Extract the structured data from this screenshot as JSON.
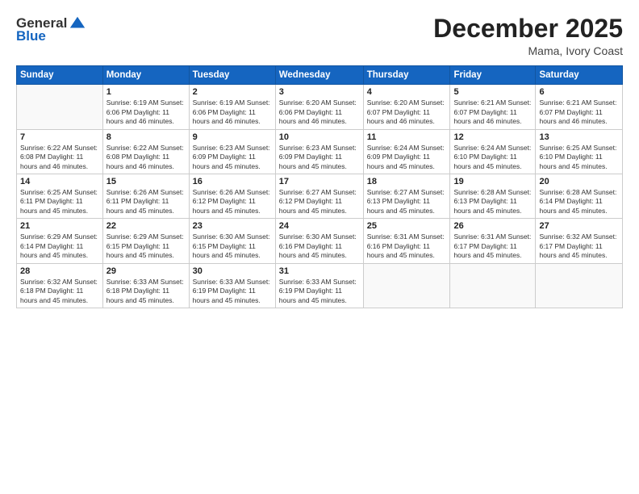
{
  "logo": {
    "general": "General",
    "blue": "Blue"
  },
  "title": "December 2025",
  "subtitle": "Mama, Ivory Coast",
  "days_of_week": [
    "Sunday",
    "Monday",
    "Tuesday",
    "Wednesday",
    "Thursday",
    "Friday",
    "Saturday"
  ],
  "weeks": [
    [
      {
        "day": "",
        "info": ""
      },
      {
        "day": "1",
        "info": "Sunrise: 6:19 AM\nSunset: 6:06 PM\nDaylight: 11 hours\nand 46 minutes."
      },
      {
        "day": "2",
        "info": "Sunrise: 6:19 AM\nSunset: 6:06 PM\nDaylight: 11 hours\nand 46 minutes."
      },
      {
        "day": "3",
        "info": "Sunrise: 6:20 AM\nSunset: 6:06 PM\nDaylight: 11 hours\nand 46 minutes."
      },
      {
        "day": "4",
        "info": "Sunrise: 6:20 AM\nSunset: 6:07 PM\nDaylight: 11 hours\nand 46 minutes."
      },
      {
        "day": "5",
        "info": "Sunrise: 6:21 AM\nSunset: 6:07 PM\nDaylight: 11 hours\nand 46 minutes."
      },
      {
        "day": "6",
        "info": "Sunrise: 6:21 AM\nSunset: 6:07 PM\nDaylight: 11 hours\nand 46 minutes."
      }
    ],
    [
      {
        "day": "7",
        "info": "Sunrise: 6:22 AM\nSunset: 6:08 PM\nDaylight: 11 hours\nand 46 minutes."
      },
      {
        "day": "8",
        "info": "Sunrise: 6:22 AM\nSunset: 6:08 PM\nDaylight: 11 hours\nand 46 minutes."
      },
      {
        "day": "9",
        "info": "Sunrise: 6:23 AM\nSunset: 6:09 PM\nDaylight: 11 hours\nand 45 minutes."
      },
      {
        "day": "10",
        "info": "Sunrise: 6:23 AM\nSunset: 6:09 PM\nDaylight: 11 hours\nand 45 minutes."
      },
      {
        "day": "11",
        "info": "Sunrise: 6:24 AM\nSunset: 6:09 PM\nDaylight: 11 hours\nand 45 minutes."
      },
      {
        "day": "12",
        "info": "Sunrise: 6:24 AM\nSunset: 6:10 PM\nDaylight: 11 hours\nand 45 minutes."
      },
      {
        "day": "13",
        "info": "Sunrise: 6:25 AM\nSunset: 6:10 PM\nDaylight: 11 hours\nand 45 minutes."
      }
    ],
    [
      {
        "day": "14",
        "info": "Sunrise: 6:25 AM\nSunset: 6:11 PM\nDaylight: 11 hours\nand 45 minutes."
      },
      {
        "day": "15",
        "info": "Sunrise: 6:26 AM\nSunset: 6:11 PM\nDaylight: 11 hours\nand 45 minutes."
      },
      {
        "day": "16",
        "info": "Sunrise: 6:26 AM\nSunset: 6:12 PM\nDaylight: 11 hours\nand 45 minutes."
      },
      {
        "day": "17",
        "info": "Sunrise: 6:27 AM\nSunset: 6:12 PM\nDaylight: 11 hours\nand 45 minutes."
      },
      {
        "day": "18",
        "info": "Sunrise: 6:27 AM\nSunset: 6:13 PM\nDaylight: 11 hours\nand 45 minutes."
      },
      {
        "day": "19",
        "info": "Sunrise: 6:28 AM\nSunset: 6:13 PM\nDaylight: 11 hours\nand 45 minutes."
      },
      {
        "day": "20",
        "info": "Sunrise: 6:28 AM\nSunset: 6:14 PM\nDaylight: 11 hours\nand 45 minutes."
      }
    ],
    [
      {
        "day": "21",
        "info": "Sunrise: 6:29 AM\nSunset: 6:14 PM\nDaylight: 11 hours\nand 45 minutes."
      },
      {
        "day": "22",
        "info": "Sunrise: 6:29 AM\nSunset: 6:15 PM\nDaylight: 11 hours\nand 45 minutes."
      },
      {
        "day": "23",
        "info": "Sunrise: 6:30 AM\nSunset: 6:15 PM\nDaylight: 11 hours\nand 45 minutes."
      },
      {
        "day": "24",
        "info": "Sunrise: 6:30 AM\nSunset: 6:16 PM\nDaylight: 11 hours\nand 45 minutes."
      },
      {
        "day": "25",
        "info": "Sunrise: 6:31 AM\nSunset: 6:16 PM\nDaylight: 11 hours\nand 45 minutes."
      },
      {
        "day": "26",
        "info": "Sunrise: 6:31 AM\nSunset: 6:17 PM\nDaylight: 11 hours\nand 45 minutes."
      },
      {
        "day": "27",
        "info": "Sunrise: 6:32 AM\nSunset: 6:17 PM\nDaylight: 11 hours\nand 45 minutes."
      }
    ],
    [
      {
        "day": "28",
        "info": "Sunrise: 6:32 AM\nSunset: 6:18 PM\nDaylight: 11 hours\nand 45 minutes."
      },
      {
        "day": "29",
        "info": "Sunrise: 6:33 AM\nSunset: 6:18 PM\nDaylight: 11 hours\nand 45 minutes."
      },
      {
        "day": "30",
        "info": "Sunrise: 6:33 AM\nSunset: 6:19 PM\nDaylight: 11 hours\nand 45 minutes."
      },
      {
        "day": "31",
        "info": "Sunrise: 6:33 AM\nSunset: 6:19 PM\nDaylight: 11 hours\nand 45 minutes."
      },
      {
        "day": "",
        "info": ""
      },
      {
        "day": "",
        "info": ""
      },
      {
        "day": "",
        "info": ""
      }
    ]
  ]
}
